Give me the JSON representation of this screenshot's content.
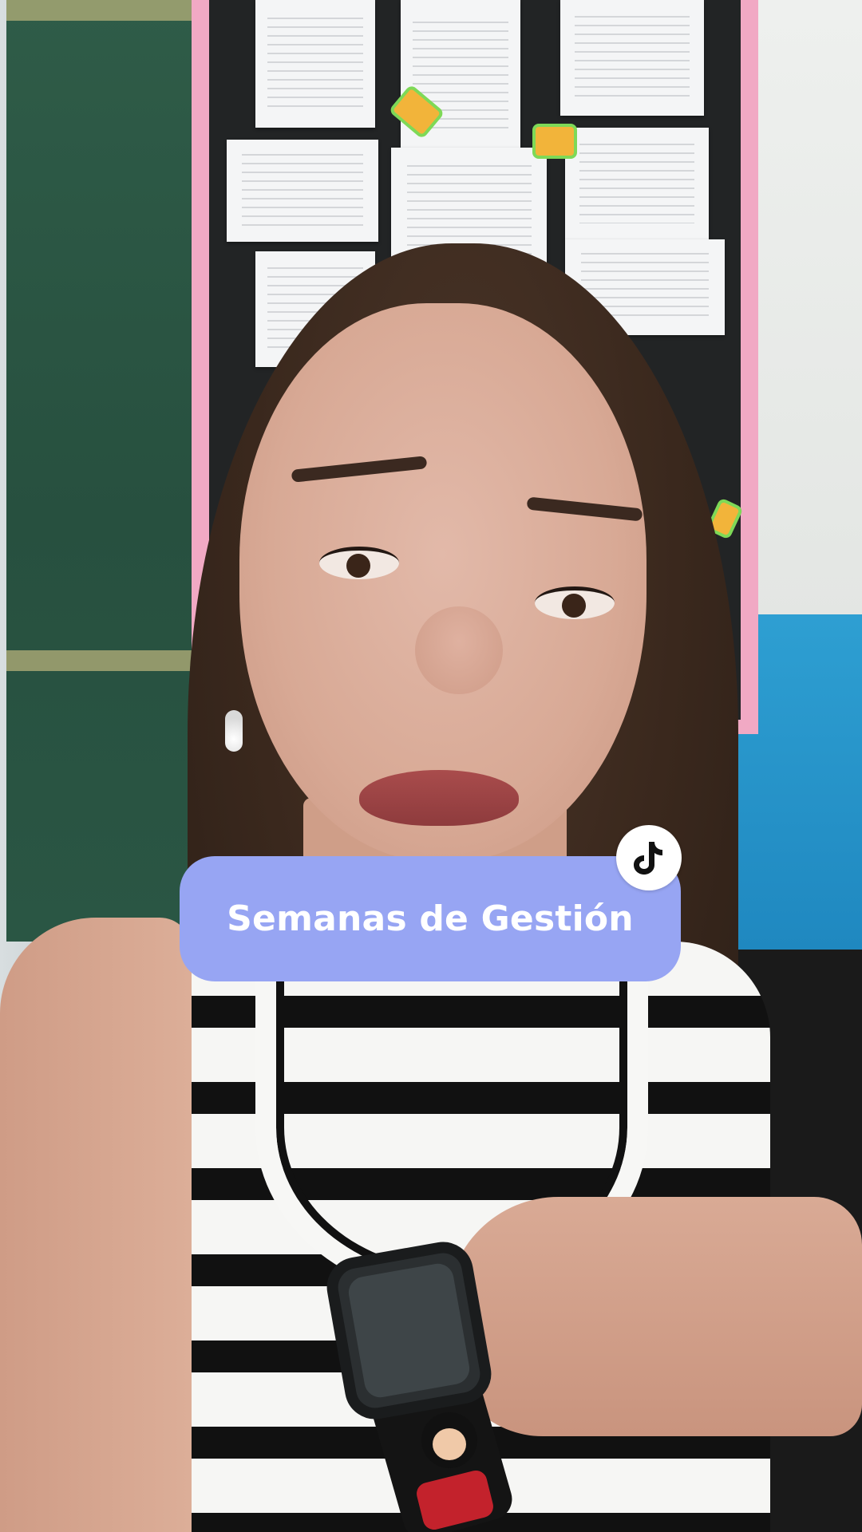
{
  "overlay": {
    "title": "Semanas de Gestión",
    "pill_color": "#97a5f3",
    "badge_icon": "tiktok-icon"
  },
  "scene": {
    "description_icon": "video-frame"
  }
}
